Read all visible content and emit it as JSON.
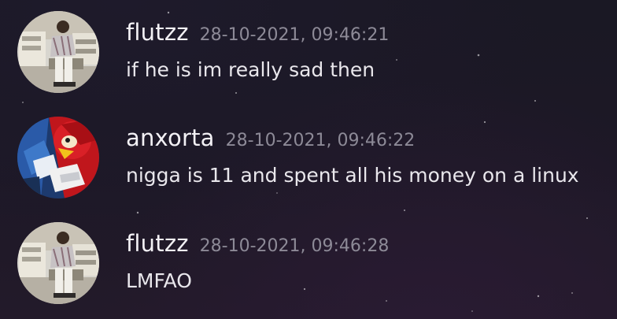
{
  "messages": [
    {
      "username": "flutzz",
      "timestamp": "28-10-2021, 09:46:21",
      "text": "if he is im really sad then",
      "avatar_icon": "office-scene-avatar"
    },
    {
      "username": "anxorta",
      "timestamp": "28-10-2021, 09:46:22",
      "text": "nigga is 11 and spent all his money on a linux",
      "avatar_icon": "red-blue-character-avatar"
    },
    {
      "username": "flutzz",
      "timestamp": "28-10-2021, 09:46:28",
      "text": "LMFAO",
      "avatar_icon": "office-scene-avatar"
    }
  ],
  "colors": {
    "background": "#1c1826",
    "username": "#f3f1f5",
    "timestamp": "#8d8a97",
    "message_text": "#e9e7ec"
  }
}
